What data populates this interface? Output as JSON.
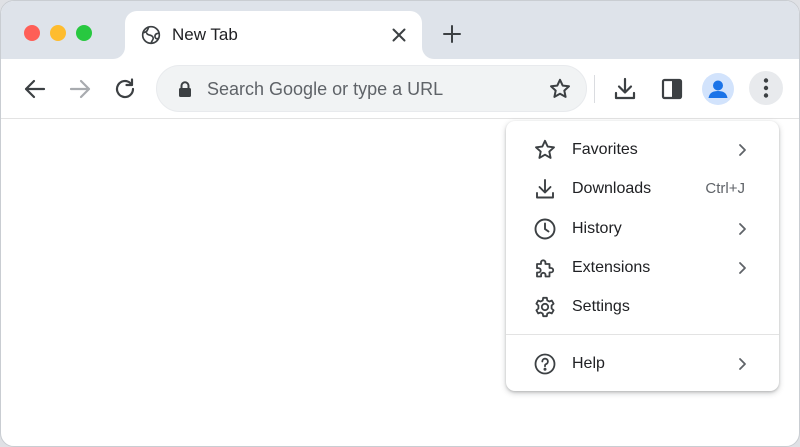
{
  "tab": {
    "title": "New Tab"
  },
  "omnibox": {
    "placeholder": "Search Google or type a URL"
  },
  "menu": {
    "items": [
      {
        "label": "Favorites",
        "icon": "star-icon",
        "submenu": true
      },
      {
        "label": "Downloads",
        "icon": "download-icon",
        "shortcut": "Ctrl+J"
      },
      {
        "label": "History",
        "icon": "clock-icon",
        "submenu": true
      },
      {
        "label": "Extensions",
        "icon": "puzzle-icon",
        "submenu": true
      },
      {
        "label": "Settings",
        "icon": "gear-icon"
      }
    ],
    "footer_items": [
      {
        "label": "Help",
        "icon": "help-icon",
        "submenu": true
      }
    ]
  },
  "colors": {
    "tabstrip": "#dee3ea",
    "traffic_red": "#fe5f57",
    "traffic_yellow": "#febc2e",
    "traffic_green": "#28c840",
    "avatar_accent": "#1a73e8",
    "icon": "#3c4043"
  }
}
